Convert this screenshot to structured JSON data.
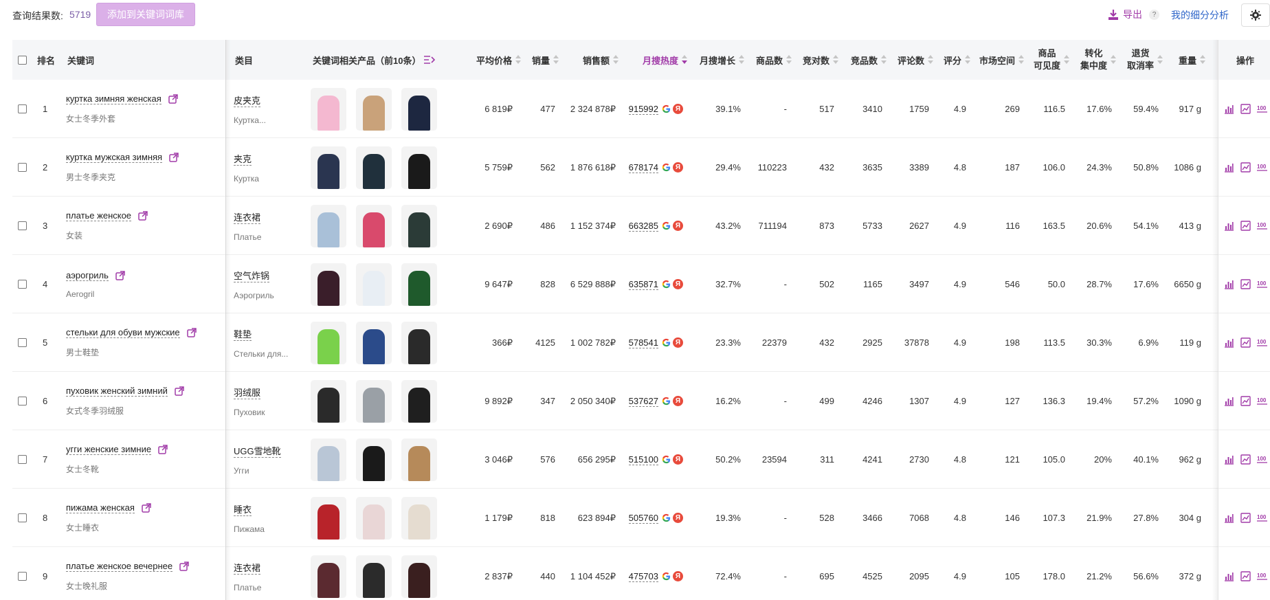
{
  "top": {
    "result_label": "查询结果数:",
    "result_count": "5719",
    "add_button": "添加到关键词词库",
    "export_label": "导出",
    "help": "?",
    "my_analysis": "我的细分分析"
  },
  "headers": {
    "rank": "排名",
    "keyword": "关键词",
    "category": "类目",
    "products": "关键词相关产品（前10条）",
    "avg_price": "平均价格",
    "sales": "销量",
    "revenue": "销售额",
    "monthly_search": "月搜热度",
    "monthly_growth": "月搜增长",
    "product_count": "商品数",
    "bid_count": "竞对数",
    "competitor_count": "竞品数",
    "review_count": "评论数",
    "rating": "评分",
    "market_space": "市场空间",
    "visibility_l1": "商品",
    "visibility_l2": "可见度",
    "conversion_l1": "转化",
    "conversion_l2": "集中度",
    "return_l1": "退货",
    "return_l2": "取消率",
    "weight": "重量",
    "actions": "操作"
  },
  "colors": {
    "accent": "#a13ba8",
    "link": "#2f66c9",
    "button_bg": "#dbb0e8"
  },
  "rows": [
    {
      "rank": "1",
      "keyword": "куртка зимняя женская",
      "keyword_cn": "女士冬季外套",
      "cat": "皮夹克",
      "cat_sub": "Куртка...",
      "price": "6 819₽",
      "sales": "477",
      "revenue": "2 324 878₽",
      "hot": "915992",
      "growth": "39.1%",
      "products": "-",
      "bids": "517",
      "competitors": "3410",
      "reviews": "1759",
      "rating": "4.9",
      "market": "269",
      "visibility": "116.5",
      "conversion": "17.6%",
      "return": "59.4%",
      "weight": "917 g"
    },
    {
      "rank": "2",
      "keyword": "куртка мужская зимняя",
      "keyword_cn": "男士冬季夹克",
      "cat": "夹克",
      "cat_sub": "Куртка",
      "price": "5 759₽",
      "sales": "562",
      "revenue": "1 876 618₽",
      "hot": "678174",
      "growth": "29.4%",
      "products": "110223",
      "bids": "432",
      "competitors": "3635",
      "reviews": "3389",
      "rating": "4.8",
      "market": "187",
      "visibility": "106.0",
      "conversion": "24.3%",
      "return": "50.8%",
      "weight": "1086 g"
    },
    {
      "rank": "3",
      "keyword": "платье женское",
      "keyword_cn": "女装",
      "cat": "连衣裙",
      "cat_sub": "Платье",
      "price": "2 690₽",
      "sales": "486",
      "revenue": "1 152 374₽",
      "hot": "663285",
      "growth": "43.2%",
      "products": "711194",
      "bids": "873",
      "competitors": "5733",
      "reviews": "2627",
      "rating": "4.9",
      "market": "116",
      "visibility": "163.5",
      "conversion": "20.6%",
      "return": "54.1%",
      "weight": "413 g"
    },
    {
      "rank": "4",
      "keyword": "аэрогриль",
      "keyword_cn": "Aerogril",
      "cat": "空气炸锅",
      "cat_sub": "Аэрогриль",
      "price": "9 647₽",
      "sales": "828",
      "revenue": "6 529 888₽",
      "hot": "635871",
      "growth": "32.7%",
      "products": "-",
      "bids": "502",
      "competitors": "1165",
      "reviews": "3497",
      "rating": "4.9",
      "market": "546",
      "visibility": "50.0",
      "conversion": "28.7%",
      "return": "17.6%",
      "weight": "6650 g"
    },
    {
      "rank": "5",
      "keyword": "стельки для обуви мужские",
      "keyword_cn": "男士鞋垫",
      "cat": "鞋垫",
      "cat_sub": "Стельки для...",
      "price": "366₽",
      "sales": "4125",
      "revenue": "1 002 782₽",
      "hot": "578541",
      "growth": "23.3%",
      "products": "22379",
      "bids": "432",
      "competitors": "2925",
      "reviews": "37878",
      "rating": "4.9",
      "market": "198",
      "visibility": "113.5",
      "conversion": "30.3%",
      "return": "6.9%",
      "weight": "119 g"
    },
    {
      "rank": "6",
      "keyword": "пуховик женский зимний",
      "keyword_cn": "女式冬季羽绒服",
      "cat": "羽绒服",
      "cat_sub": "Пуховик",
      "price": "9 892₽",
      "sales": "347",
      "revenue": "2 050 340₽",
      "hot": "537627",
      "growth": "16.2%",
      "products": "-",
      "bids": "499",
      "competitors": "4246",
      "reviews": "1307",
      "rating": "4.9",
      "market": "127",
      "visibility": "136.3",
      "conversion": "19.4%",
      "return": "57.2%",
      "weight": "1090 g"
    },
    {
      "rank": "7",
      "keyword": "угги женские зимние",
      "keyword_cn": "女士冬靴",
      "cat": "UGG雪地靴",
      "cat_sub": "Угги",
      "price": "3 046₽",
      "sales": "576",
      "revenue": "656 295₽",
      "hot": "515100",
      "growth": "50.2%",
      "products": "23594",
      "bids": "311",
      "competitors": "4241",
      "reviews": "2730",
      "rating": "4.8",
      "market": "121",
      "visibility": "105.0",
      "conversion": "20%",
      "return": "40.1%",
      "weight": "962 g"
    },
    {
      "rank": "8",
      "keyword": "пижама женская",
      "keyword_cn": "女士睡衣",
      "cat": "睡衣",
      "cat_sub": "Пижама",
      "price": "1 179₽",
      "sales": "818",
      "revenue": "623 894₽",
      "hot": "505760",
      "growth": "19.3%",
      "products": "-",
      "bids": "528",
      "competitors": "3466",
      "reviews": "7068",
      "rating": "4.8",
      "market": "146",
      "visibility": "107.3",
      "conversion": "21.9%",
      "return": "27.8%",
      "weight": "304 g"
    },
    {
      "rank": "9",
      "keyword": "платье женское вечернее",
      "keyword_cn": "女士晚礼服",
      "cat": "连衣裙",
      "cat_sub": "Платье",
      "price": "2 837₽",
      "sales": "440",
      "revenue": "1 104 452₽",
      "hot": "475703",
      "growth": "72.4%",
      "products": "-",
      "bids": "695",
      "competitors": "4525",
      "reviews": "2095",
      "rating": "4.9",
      "market": "105",
      "visibility": "178.0",
      "conversion": "21.2%",
      "return": "56.6%",
      "weight": "372 g"
    }
  ],
  "thumb_colors": [
    [
      "#f4b8d0",
      "#c9a27a",
      "#1d2740"
    ],
    [
      "#2a3550",
      "#20303c",
      "#1a1a1a"
    ],
    [
      "#a9c0d8",
      "#d94a6c",
      "#2b3b37"
    ],
    [
      "#3a1e2a",
      "#e8eef4",
      "#1f5a2c"
    ],
    [
      "#7ad14b",
      "#2b4b8a",
      "#2a2a2a"
    ],
    [
      "#2a2a2a",
      "#9aa0a6",
      "#1f1f1f"
    ],
    [
      "#b9c6d6",
      "#1a1a1a",
      "#b68a5a"
    ],
    [
      "#b8232a",
      "#e9d6d6",
      "#e5dcd0"
    ],
    [
      "#5b2a30",
      "#2b2b2b",
      "#3a1f1f"
    ]
  ]
}
